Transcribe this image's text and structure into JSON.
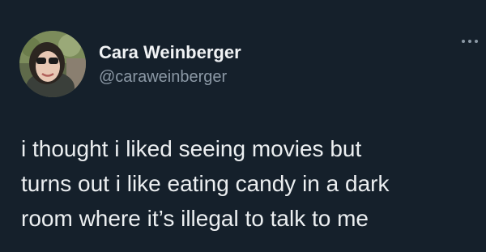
{
  "author": {
    "name": "Cara Weinberger",
    "handle": "@caraweinberger"
  },
  "tweet": {
    "lines": [
      "i thought i liked seeing movies but",
      "turns out i like eating candy in a dark",
      "room where it’s illegal to talk to me"
    ]
  },
  "icons": {
    "avatar": "profile-photo",
    "more": "more-icon"
  },
  "colors": {
    "background": "#15202b",
    "text": "#e7e9ea",
    "handle": "#8b98a5"
  }
}
